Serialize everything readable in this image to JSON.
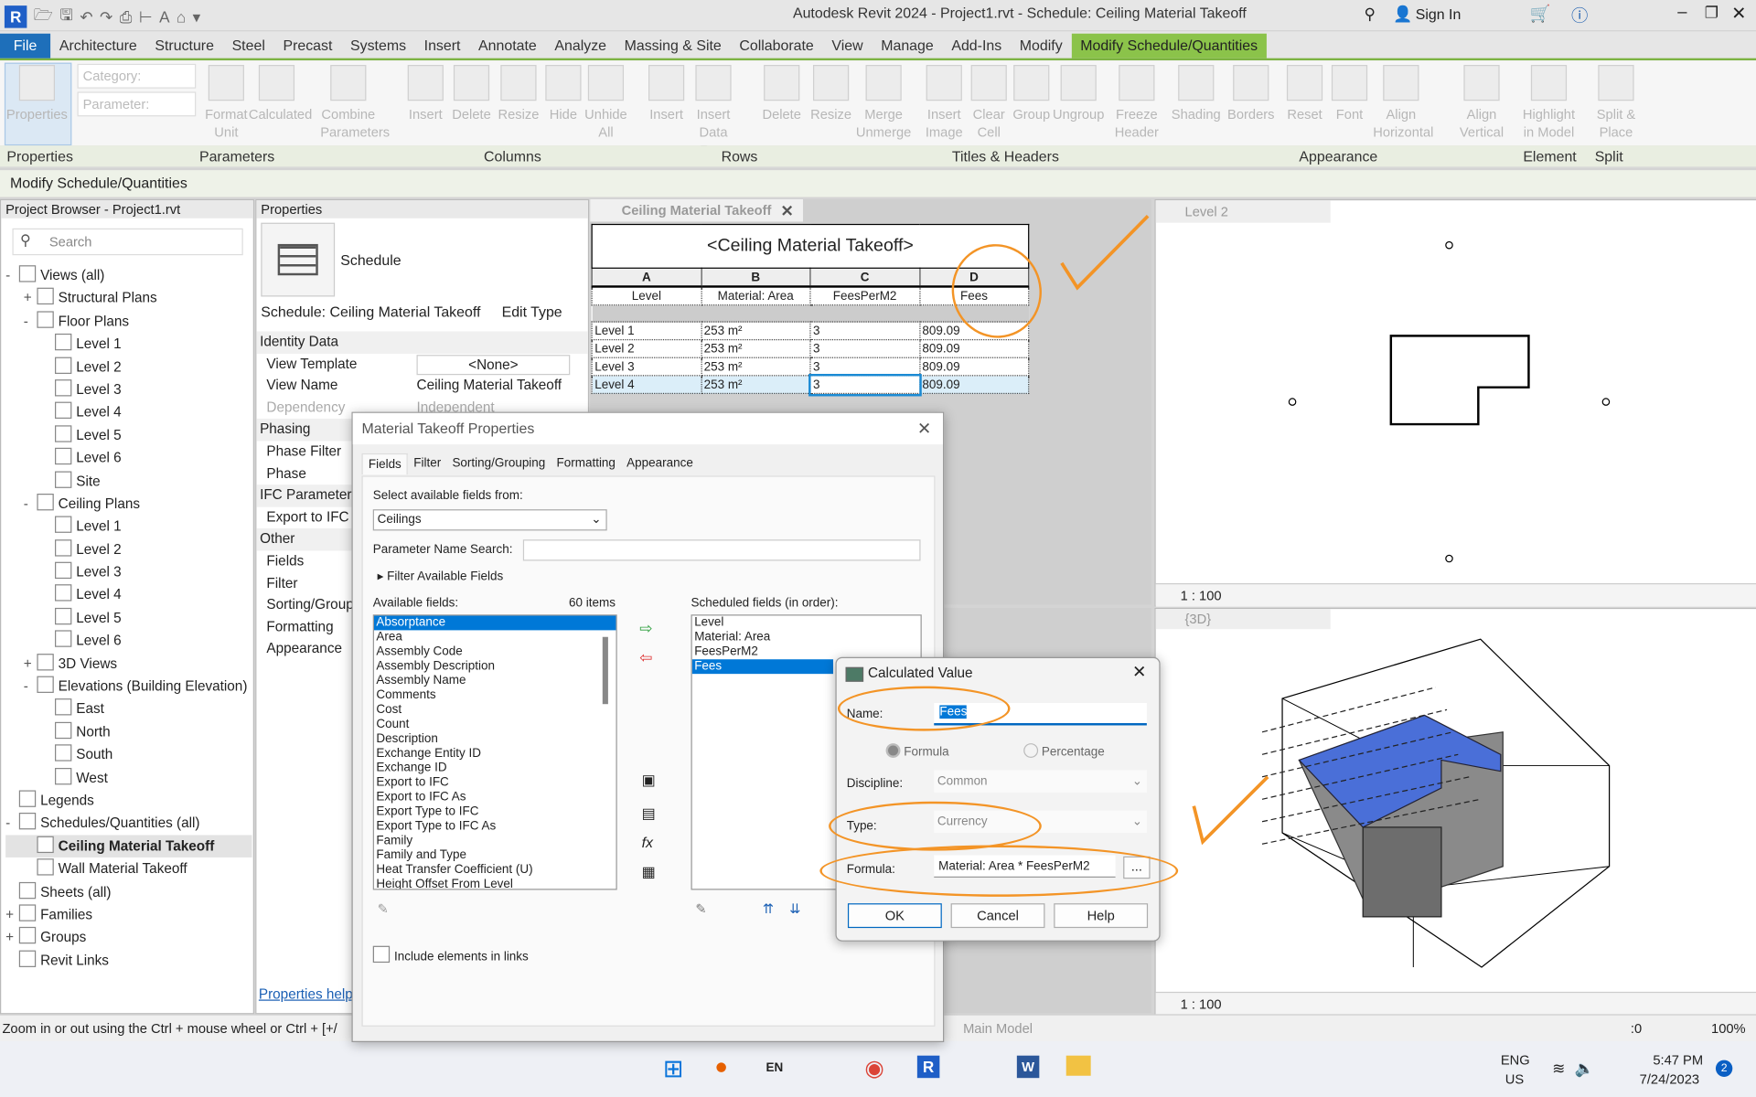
{
  "app": {
    "title": "Autodesk Revit 2024 - Project1.rvt - Schedule: Ceiling Material Takeoff",
    "sign_in": "Sign In"
  },
  "menu_tabs": [
    "File",
    "Architecture",
    "Structure",
    "Steel",
    "Precast",
    "Systems",
    "Insert",
    "Annotate",
    "Analyze",
    "Massing & Site",
    "Collaborate",
    "View",
    "Manage",
    "Add-Ins",
    "Modify",
    "Modify Schedule/Quantities"
  ],
  "ribbon": {
    "category_placeholder": "Category:",
    "parameter_placeholder": "Parameter:",
    "buttons": [
      [
        "Properties",
        ""
      ],
      [
        "Format",
        "Unit"
      ],
      [
        "Calculated",
        ""
      ],
      [
        "Combine",
        "Parameters"
      ],
      [
        "Insert",
        ""
      ],
      [
        "Delete",
        ""
      ],
      [
        "Resize",
        ""
      ],
      [
        "Hide",
        ""
      ],
      [
        "Unhide",
        "All"
      ],
      [
        "Insert",
        ""
      ],
      [
        "Insert",
        "Data Row"
      ],
      [
        "Delete",
        ""
      ],
      [
        "Resize",
        ""
      ],
      [
        "Merge",
        "Unmerge"
      ],
      [
        "Insert",
        "Image"
      ],
      [
        "Clear",
        "Cell"
      ],
      [
        "Group",
        ""
      ],
      [
        "Ungroup",
        ""
      ],
      [
        "Freeze",
        "Header"
      ],
      [
        "Shading",
        ""
      ],
      [
        "Borders",
        ""
      ],
      [
        "Reset",
        ""
      ],
      [
        "Font",
        ""
      ],
      [
        "Align",
        "Horizontal"
      ],
      [
        "Align",
        "Vertical"
      ],
      [
        "Highlight",
        "in Model"
      ],
      [
        "Split &",
        "Place"
      ]
    ],
    "panels": [
      "Properties",
      "Parameters",
      "Columns",
      "Rows",
      "Titles & Headers",
      "Appearance",
      "Element",
      "Split"
    ]
  },
  "context_bar": "Modify Schedule/Quantities",
  "project_browser": {
    "title": "Project Browser - Project1.rvt",
    "search_placeholder": "Search",
    "items": [
      {
        "t": "Views (all)",
        "l": 0,
        "e": "-"
      },
      {
        "t": "Structural Plans",
        "l": 1,
        "e": "+"
      },
      {
        "t": "Floor Plans",
        "l": 1,
        "e": "-"
      },
      {
        "t": "Level 1",
        "l": 2
      },
      {
        "t": "Level 2",
        "l": 2
      },
      {
        "t": "Level 3",
        "l": 2
      },
      {
        "t": "Level 4",
        "l": 2
      },
      {
        "t": "Level 5",
        "l": 2
      },
      {
        "t": "Level 6",
        "l": 2
      },
      {
        "t": "Site",
        "l": 2
      },
      {
        "t": "Ceiling Plans",
        "l": 1,
        "e": "-"
      },
      {
        "t": "Level 1",
        "l": 2
      },
      {
        "t": "Level 2",
        "l": 2
      },
      {
        "t": "Level 3",
        "l": 2
      },
      {
        "t": "Level 4",
        "l": 2
      },
      {
        "t": "Level 5",
        "l": 2
      },
      {
        "t": "Level 6",
        "l": 2
      },
      {
        "t": "3D Views",
        "l": 1,
        "e": "+"
      },
      {
        "t": "Elevations (Building Elevation)",
        "l": 1,
        "e": "-"
      },
      {
        "t": "East",
        "l": 2
      },
      {
        "t": "North",
        "l": 2
      },
      {
        "t": "South",
        "l": 2
      },
      {
        "t": "West",
        "l": 2
      },
      {
        "t": "Legends",
        "l": 0
      },
      {
        "t": "Schedules/Quantities (all)",
        "l": 0,
        "e": "-"
      },
      {
        "t": "Ceiling Material Takeoff",
        "l": 1,
        "sel": true
      },
      {
        "t": "Wall Material Takeoff",
        "l": 1
      },
      {
        "t": "Sheets (all)",
        "l": 0
      },
      {
        "t": "Families",
        "l": 0,
        "e": "+"
      },
      {
        "t": "Groups",
        "l": 0,
        "e": "+"
      },
      {
        "t": "Revit Links",
        "l": 0
      }
    ]
  },
  "properties": {
    "title": "Properties",
    "type_name": "Schedule",
    "selector": "Schedule: Ceiling Material Takeoff",
    "edit_type": "Edit Type",
    "rows": [
      {
        "g": "Identity Data"
      },
      {
        "k": "View Template",
        "v": "<None>"
      },
      {
        "k": "View Name",
        "v": "Ceiling Material Takeoff"
      },
      {
        "k": "Dependency",
        "v": "Independent"
      },
      {
        "g": "Phasing"
      },
      {
        "k": "Phase Filter"
      },
      {
        "k": "Phase"
      },
      {
        "g": "IFC Parameters"
      },
      {
        "k": "Export to IFC"
      },
      {
        "g": "Other"
      },
      {
        "k": "Fields"
      },
      {
        "k": "Filter"
      },
      {
        "k": "Sorting/Group"
      },
      {
        "k": "Formatting"
      },
      {
        "k": "Appearance"
      }
    ],
    "help_link": "Properties help"
  },
  "schedule_view": {
    "tab": "Ceiling Material Takeoff",
    "title": "<Ceiling Material Takeoff>",
    "col_letters": [
      "A",
      "B",
      "C",
      "D"
    ],
    "headers": [
      "Level",
      "Material: Area",
      "FeesPerM2",
      "Fees"
    ],
    "rows": [
      [
        "Level 1",
        "253 m²",
        "3",
        "809.09"
      ],
      [
        "Level 2",
        "253 m²",
        "3",
        "809.09"
      ],
      [
        "Level 3",
        "253 m²",
        "3",
        "809.09"
      ],
      [
        "Level 4",
        "253 m²",
        "3",
        "809.09"
      ]
    ]
  },
  "plan_view": {
    "tab": "Level 2",
    "scale": "1 : 100"
  },
  "view3d": {
    "tab": "{3D}",
    "scale": "1 : 100"
  },
  "takeoff_dialog": {
    "title": "Material Takeoff Properties",
    "tabs": [
      "Fields",
      "Filter",
      "Sorting/Grouping",
      "Formatting",
      "Appearance"
    ],
    "select_from_label": "Select available fields from:",
    "select_from_value": "Ceilings",
    "param_search_label": "Parameter Name Search:",
    "filter_label": "Filter Available Fields",
    "available_label": "Available fields:",
    "available_count": "60 items",
    "available": [
      "Absorptance",
      "Area",
      "Assembly Code",
      "Assembly Description",
      "Assembly Name",
      "Comments",
      "Cost",
      "Count",
      "Description",
      "Exchange Entity ID",
      "Exchange ID",
      "Export to IFC",
      "Export to IFC As",
      "Export Type to IFC",
      "Export Type to IFC As",
      "Family",
      "Family and Type",
      "Heat Transfer Coefficient (U)",
      "Height Offset From Level"
    ],
    "scheduled_label": "Scheduled fields (in order):",
    "scheduled": [
      "Level",
      "Material: Area",
      "FeesPerM2",
      "Fees"
    ],
    "include_links": "Include elements in links"
  },
  "calc_dialog": {
    "title": "Calculated Value",
    "name_label": "Name:",
    "name_value": "Fees",
    "formula_radio": "Formula",
    "percentage_radio": "Percentage",
    "discipline_label": "Discipline:",
    "discipline_value": "Common",
    "type_label": "Type:",
    "type_value": "Currency",
    "formula_label": "Formula:",
    "formula_value": "Material: Area * FeesPerM2",
    "browse": "...",
    "ok": "OK",
    "cancel": "Cancel",
    "help": "Help"
  },
  "status": {
    "hint": "Zoom in or out using the Ctrl + mouse wheel or Ctrl + [+/",
    "model": "Main Model",
    "filter_count": ":0",
    "zoom": "100%"
  },
  "taskbar": {
    "lang": "ENG",
    "region": "US",
    "time": "5:47 PM",
    "date": "7/24/2023",
    "notif": "2",
    "ime": "EN"
  },
  "colors": {
    "accent": "#8bc34a",
    "file_tab": "#1e6fba",
    "selection": "#0078d7",
    "annotation": "#f39426",
    "ceiling": "#4a6fd8"
  }
}
